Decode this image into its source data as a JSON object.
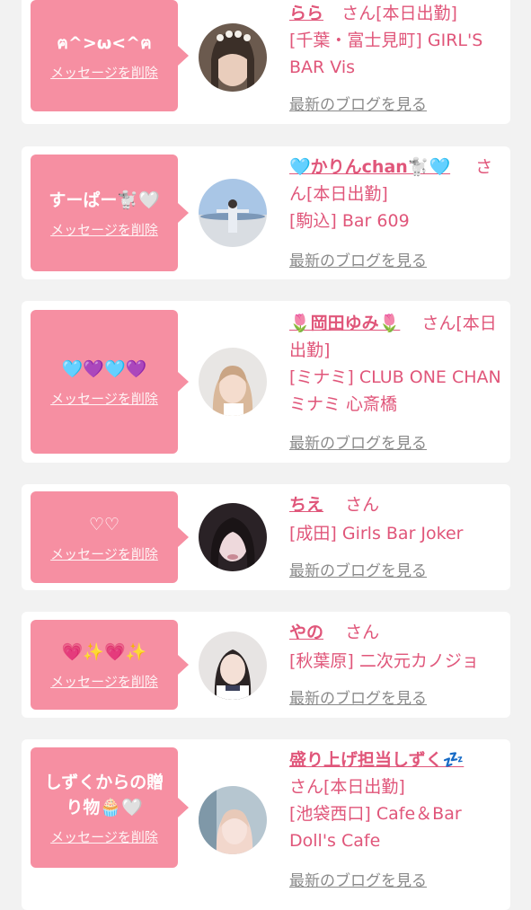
{
  "common": {
    "delete_label": "メッセージを削除",
    "san_label": "さん",
    "blog_label": "最新のブログを見る"
  },
  "cards": [
    {
      "message": "ฅ^>ω<^ฅ",
      "name": "らら",
      "status": "[本日出勤]",
      "shop": "[千葉・富士見町] GIRL'S BAR Vis"
    },
    {
      "message": "すーぱー🐩🤍",
      "name": "🩵かりんchan🐩🩵",
      "status": "[本日出勤]",
      "shop": "[駒込] Bar 609"
    },
    {
      "message": "🩵💜🩵💜",
      "name": "🌷岡田ゆみ🌷",
      "status": "[本日出勤]",
      "shop": "[ミナミ] CLUB ONE CHAN ミナミ 心斎橋"
    },
    {
      "message": "♡♡",
      "name": "ちえ",
      "status": "",
      "shop": "[成田] Girls Bar Joker"
    },
    {
      "message": "💗✨💗✨",
      "name": "やの",
      "status": "",
      "shop": "[秋葉原] 二次元カノジョ"
    },
    {
      "message": "しずくからの贈り物🧁🤍",
      "name": "盛り上げ担当しずく💤",
      "status": "[本日出勤]",
      "shop": "[池袋西口] Cafe＆Bar Doll's Cafe"
    }
  ]
}
